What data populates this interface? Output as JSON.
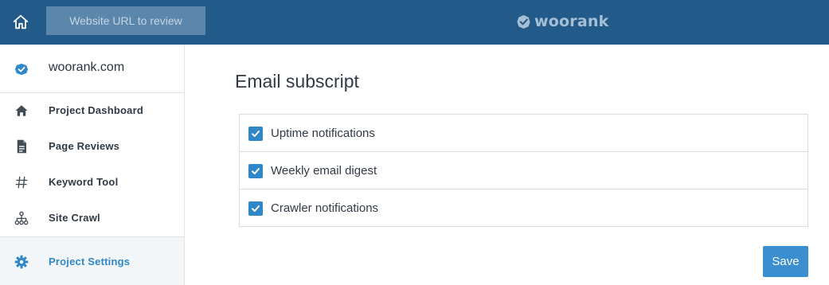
{
  "header": {
    "url_placeholder": "Website URL to review",
    "brand_name": "woorank"
  },
  "sidebar": {
    "project_name": "woorank.com",
    "items": [
      {
        "label": "Project Dashboard",
        "icon": "home-icon"
      },
      {
        "label": "Page Reviews",
        "icon": "document-icon"
      },
      {
        "label": "Keyword Tool",
        "icon": "hashtag-icon"
      },
      {
        "label": "Site Crawl",
        "icon": "sitemap-icon"
      },
      {
        "label": "Project Settings",
        "icon": "gear-icon",
        "active": true
      }
    ]
  },
  "main": {
    "title": "Email subscript",
    "options": [
      {
        "label": "Uptime notifications",
        "checked": true
      },
      {
        "label": "Weekly email digest",
        "checked": true
      },
      {
        "label": "Crawler notifications",
        "checked": true
      }
    ],
    "save_label": "Save"
  },
  "colors": {
    "header_bg": "#225b8a",
    "accent": "#2f87c8",
    "save_button": "#3b8fd0"
  }
}
